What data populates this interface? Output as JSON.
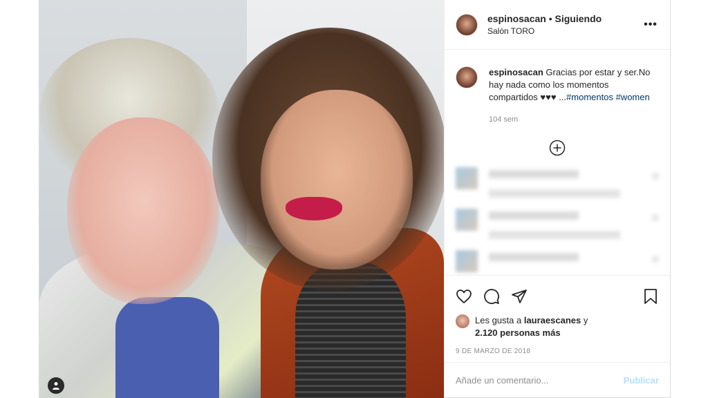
{
  "post": {
    "username": "espinosacan",
    "separator": "•",
    "follow_status": "Siguiendo",
    "location": "Salón TORO"
  },
  "caption": {
    "username": "espinosacan",
    "text": "Gracias por estar y ser.No hay nada como los momentos compartidos ♥♥♥ ...",
    "hashtags": [
      "#momentos",
      "#women"
    ],
    "time": "104 sem"
  },
  "icons": {
    "more": "more-options-icon",
    "load_more": "plus-circle-icon",
    "like": "heart-icon",
    "comment": "comment-icon",
    "share": "share-icon",
    "save": "bookmark-icon",
    "user_tag": "user-tag-icon"
  },
  "likes": {
    "prefix": "Les gusta a",
    "liker": "lauraescanes",
    "conjunction": "y",
    "count_text": "2.120 personas más"
  },
  "date": "9 de marzo de 2018",
  "comment_input": {
    "placeholder": "Añade un comentario...",
    "value": ""
  },
  "publish_label": "Publicar",
  "colors": {
    "hashtag": "#00376b",
    "publish_disabled": "#b2dffc",
    "muted": "#8e8e8e",
    "border": "#dbdbdb"
  }
}
